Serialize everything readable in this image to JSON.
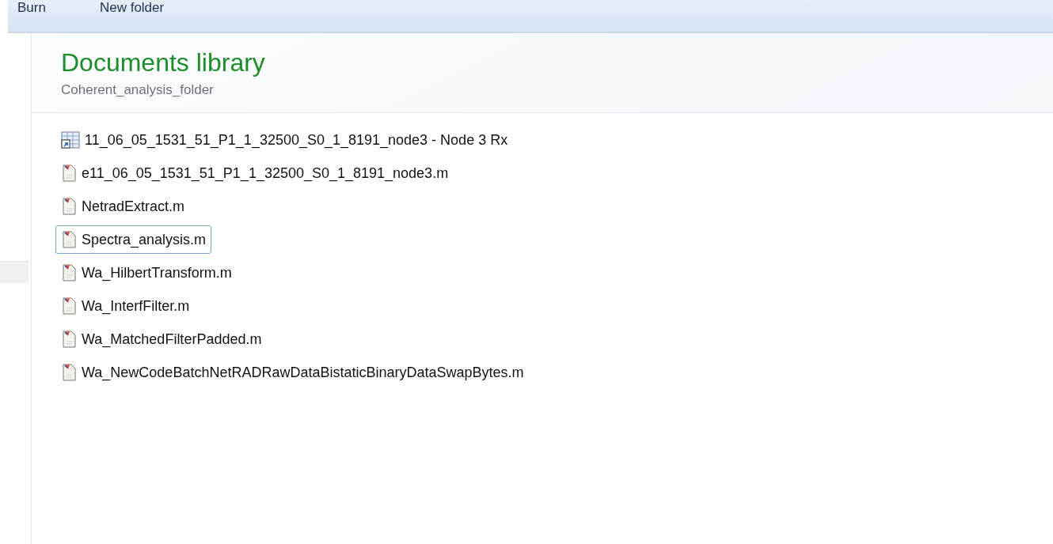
{
  "toolbar": {
    "buttons": [
      "Burn",
      "New folder"
    ]
  },
  "header": {
    "title": "Documents library",
    "subtitle": "Coherent_analysis_folder"
  },
  "files": [
    {
      "name": "11_06_05_1531_51_P1_1_32500_S0_1_8191_node3 - Node 3 Rx",
      "kind": "shortcut",
      "selected": false
    },
    {
      "name": "e11_06_05_1531_51_P1_1_32500_S0_1_8191_node3.m",
      "kind": "mfile",
      "selected": false
    },
    {
      "name": "NetradExtract.m",
      "kind": "mfile",
      "selected": false
    },
    {
      "name": "Spectra_analysis.m",
      "kind": "mfile",
      "selected": true
    },
    {
      "name": "Wa_HilbertTransform.m",
      "kind": "mfile",
      "selected": false
    },
    {
      "name": "Wa_InterfFilter.m",
      "kind": "mfile",
      "selected": false
    },
    {
      "name": "Wa_MatchedFilterPadded.m",
      "kind": "mfile",
      "selected": false
    },
    {
      "name": "Wa_NewCodeBatchNetRADRawDataBistaticBinaryDataSwapBytes.m",
      "kind": "mfile",
      "selected": false
    }
  ]
}
